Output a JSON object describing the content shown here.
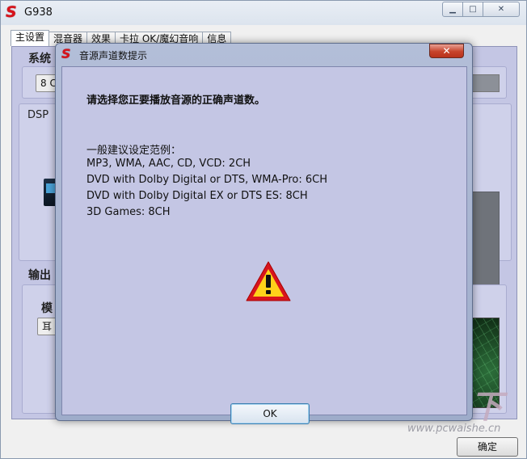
{
  "main": {
    "title": "G938",
    "logo": "S",
    "window_controls": {
      "minimize": "▁",
      "maximize": "□",
      "close": "✕"
    },
    "tabs": [
      {
        "label": "主设置",
        "active": true
      },
      {
        "label": "混音器",
        "active": false
      },
      {
        "label": "效果",
        "active": false
      },
      {
        "label": "卡拉 OK/魔幻音响",
        "active": false
      },
      {
        "label": "信息",
        "active": false
      }
    ],
    "groups": {
      "system_title": "系统",
      "channel_value": "8 C",
      "dsp_title": "DSP",
      "output_title": "输出",
      "mode_label": "模",
      "headphone_value": "耳"
    },
    "ok_button": "确定"
  },
  "watermark": {
    "text": "外设天下",
    "url": "www.pcwaishe.cn"
  },
  "dialog": {
    "logo": "S",
    "title": "音源声道数提示",
    "close": "✕",
    "prompt": "请选择您正要播放音源的正确声道数。",
    "example_heading": "一般建议设定范例：",
    "examples": [
      "MP3, WMA, AAC, CD, VCD: 2CH",
      "DVD with Dolby Digital or DTS, WMA-Pro: 6CH",
      "DVD with Dolby Digital EX or DTS ES: 8CH",
      "3D Games: 8CH"
    ],
    "icon": "warning-icon",
    "ok_label": "OK"
  }
}
